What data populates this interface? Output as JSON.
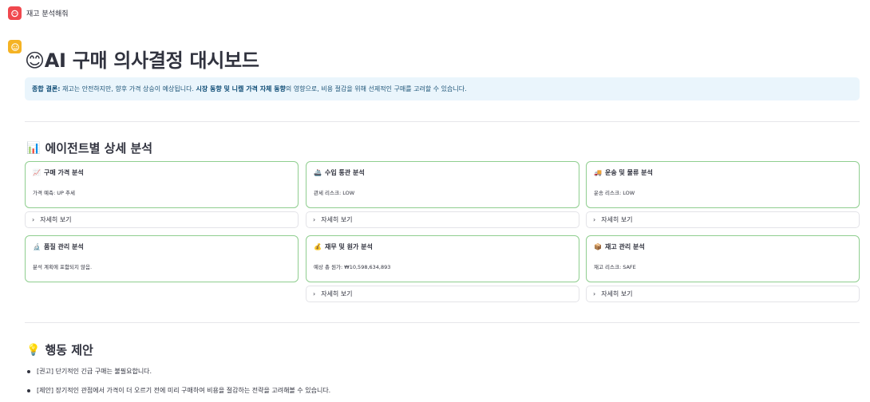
{
  "app": {
    "title": "재고 분석해줘"
  },
  "header": {
    "title_emoji": "😊",
    "title": "AI 구매 의사결정 대시보드"
  },
  "summary": {
    "label": "종합 결론:",
    "text_1": " 재고는 안전하지만, 향후 가격 상승이 예상됩니다. ",
    "highlight": "시장 동향 및 니켈 가격 자체 동향",
    "text_2": "의 영향으로, 비용 절감을 위해 선제적인 구매를 고려할 수 있습니다."
  },
  "agents_section": {
    "icon": "📊",
    "title": "에이전트별 상세 분석",
    "expander_label": "자세히 보기",
    "cards": [
      {
        "icon": "📈",
        "title": "구매 가격 분석",
        "body": "가격 예측: UP 추세",
        "has_expander": true
      },
      {
        "icon": "🚢",
        "title": "수입 통관 분석",
        "body": "관세 리스크: LOW",
        "has_expander": true
      },
      {
        "icon": "🚚",
        "title": "운송 및 물류 분석",
        "body": "운송 리스크: LOW",
        "has_expander": true
      },
      {
        "icon": "🔬",
        "title": "품질 관리 분석",
        "body": "분석 계획에 포함되지 않음.",
        "has_expander": false
      },
      {
        "icon": "💰",
        "title": "재무 및 원가 분석",
        "body": "예상 총 원가: ₩10,598,634,893",
        "has_expander": true
      },
      {
        "icon": "📦",
        "title": "재고 관리 분석",
        "body": "재고 리스크: SAFE",
        "has_expander": true
      }
    ]
  },
  "actions_section": {
    "icon": "💡",
    "title": "행동 제안",
    "items": [
      "[권고] 단기적인 긴급 구매는 불필요합니다.",
      "[제안] 장기적인 관점에서 가격이 더 오르기 전에 미리 구매하여 비용을 절감하는 전략을 고려해볼 수 있습니다."
    ]
  },
  "colors": {
    "card_border": "#8fce8f",
    "summary_bg": "#eaf5fc",
    "app_icon": "#f0484e",
    "avatar": "#f5b324"
  }
}
